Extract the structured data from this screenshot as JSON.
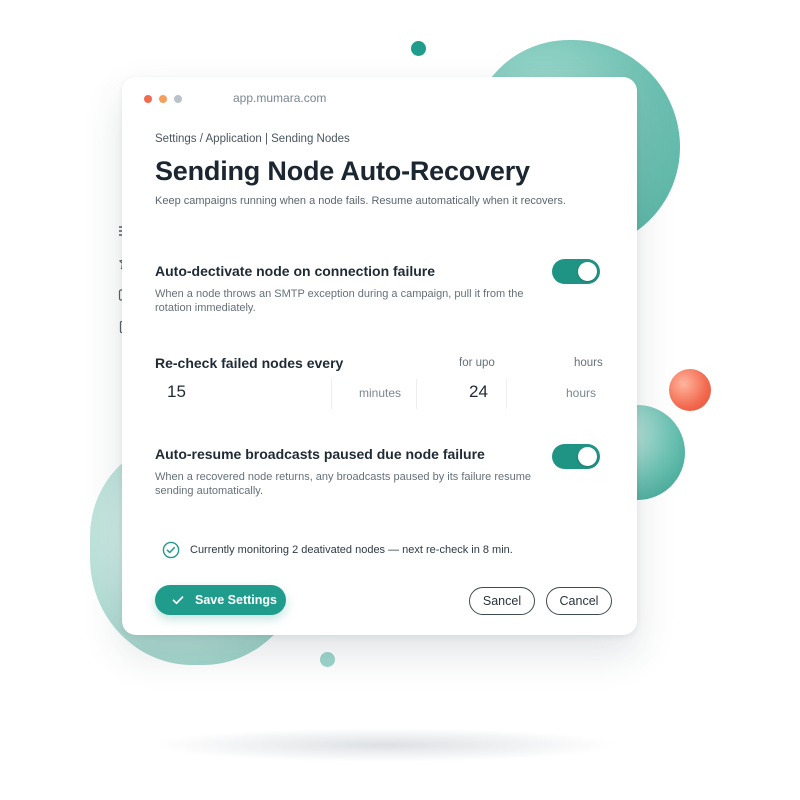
{
  "browser": {
    "url": "app.mumara.com"
  },
  "breadcrumb": "Settings / Application | Sending Nodes",
  "page": {
    "title": "Sending Node Auto-Recovery",
    "subtitle": "Keep campaigns running when a node fails. Resume automatically when it recovers."
  },
  "sidebar": {
    "icons": [
      "menu-icon",
      "pin-icon",
      "inbox-icon",
      "document-icon"
    ]
  },
  "settings": {
    "auto_deactivate": {
      "title": "Auto-dectivate node on connection failure",
      "description": "When a node throws an SMTP exception during a campaign, pull it from the rotation immediately.",
      "enabled": true
    },
    "recheck": {
      "title": "Re-check failed nodes every",
      "interval_value": "15",
      "interval_unit": "minutes",
      "limit_label": "for upo",
      "limit_value": "24",
      "limit_unit_header": "hours",
      "limit_unit": "hours"
    },
    "auto_resume": {
      "title": "Auto-resume broadcasts paused due node failure",
      "description": "When a recovered node returns, any broadcasts paused by its failure resume sending automatically.",
      "enabled": true
    }
  },
  "status": {
    "text": "Currently monitoring 2 deativated nodes — next re-check in 8 min."
  },
  "actions": {
    "save_label": "Save Settings",
    "cancel_label_1": "Sancel",
    "cancel_label_2": "Cancel"
  },
  "colors": {
    "accent": "#1f9c8c",
    "toggle_on": "#1f9484",
    "orb": "#f26a4f"
  }
}
